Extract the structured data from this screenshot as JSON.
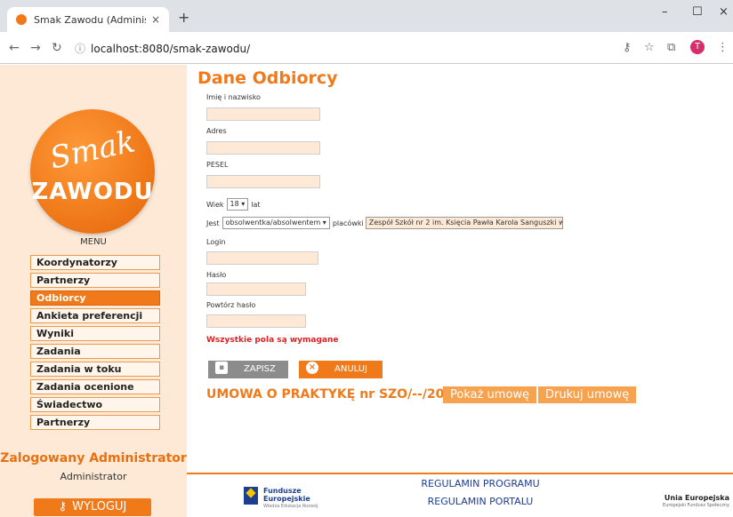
{
  "browser": {
    "tab_title": "Smak Zawodu (Administrator)",
    "tab_close": "×",
    "new_tab": "+",
    "url": "localhost:8080/smak-zawodu/",
    "avatar_letter": "T",
    "win_min": "–",
    "win_max": "☐",
    "win_close": "×"
  },
  "sidebar": {
    "logo_line1": "Smak",
    "logo_line2": "ZAWODU",
    "menu_title": "MENU",
    "items": [
      {
        "label": "Koordynatorzy"
      },
      {
        "label": "Partnerzy"
      },
      {
        "label": "Odbiorcy",
        "active": true
      },
      {
        "label": "Ankieta preferencji"
      },
      {
        "label": "Wyniki"
      },
      {
        "label": "Zadania"
      },
      {
        "label": "Zadania w toku"
      },
      {
        "label": "Zadania ocenione"
      },
      {
        "label": "Świadectwo"
      },
      {
        "label": "Partnerzy"
      }
    ],
    "logged_in": "Zalogowany Administrator",
    "user_name": "Administrator",
    "logout_label": "WYLOGUJ"
  },
  "form": {
    "title": "Dane Odbiorcy",
    "name_label": "Imię i nazwisko",
    "address_label": "Adres",
    "pesel_label": "PESEL",
    "age_label": "Wiek",
    "age_value": "18",
    "age_unit": "lat",
    "is_label": "Jest",
    "status_value": "obsolwentka/absolwentem",
    "school_label": "placówki",
    "school_value": "Zespół Szkół nr 2 im. Księcia Pawła Karola Sanguszki w",
    "login_label": "Login",
    "password_label": "Hasło",
    "password_repeat_label": "Powtórz hasło",
    "required_note": "Wszystkie pola są wymagane",
    "save_label": "ZAPISZ",
    "cancel_label": "ANULUJ",
    "contract_text": "UMOWA O PRAKTYKĘ nr SZO/--/2019",
    "show_contract": "Pokaż umowę",
    "print_contract": "Drukuj umowę"
  },
  "footer": {
    "fe_line1": "Fundusze",
    "fe_line2": "Europejskie",
    "fe_sub": "Wiedza Edukacja Rozwój",
    "reg_program": "REGULAMIN PROGRAMU",
    "reg_portal": "REGULAMIN PORTALU",
    "ue_line": "Unia Europejska",
    "ue_sub": "Europejski Fundusz Społeczny"
  },
  "colors": {
    "accent": "#f07a1a",
    "sidebar_bg": "#fde9d6",
    "error": "#e02020",
    "link": "#1c3d92"
  }
}
